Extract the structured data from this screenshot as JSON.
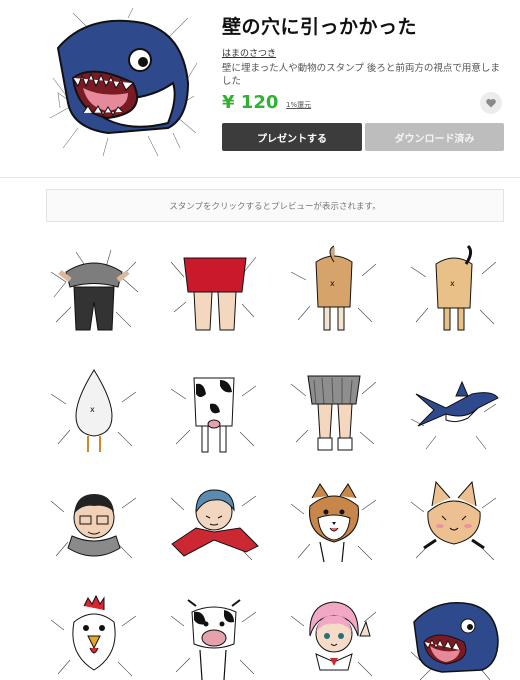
{
  "sticker": {
    "title": "壁の穴に引っかかった",
    "author": "はまのさつき",
    "description": "壁に埋まった人や動物のスタンプ 後ろと前両方の視点で用意しました",
    "price": "¥ 120",
    "coin_link": "1%還元",
    "gift_button": "プレゼントする",
    "download_button": "ダウンロード済み"
  },
  "preview": {
    "hint": "スタンプをクリックするとプレビューが表示されます。"
  },
  "stickers": [
    {
      "name": "person-gray-back"
    },
    {
      "name": "woman-red-skirt-back"
    },
    {
      "name": "dog-back"
    },
    {
      "name": "cat-back"
    },
    {
      "name": "chicken-back"
    },
    {
      "name": "cow-back"
    },
    {
      "name": "schoolgirl-back"
    },
    {
      "name": "shark-back"
    },
    {
      "name": "man-glasses-front"
    },
    {
      "name": "blue-hair-girl-front"
    },
    {
      "name": "shiba-dog-front"
    },
    {
      "name": "cat-front"
    },
    {
      "name": "chicken-front"
    },
    {
      "name": "cow-front"
    },
    {
      "name": "pink-hair-girl-front"
    },
    {
      "name": "shark-front"
    }
  ],
  "colors": {
    "price_green": "#2fb233",
    "gift_button": "#3c3c3c",
    "download_disabled": "#bdbdbd"
  }
}
